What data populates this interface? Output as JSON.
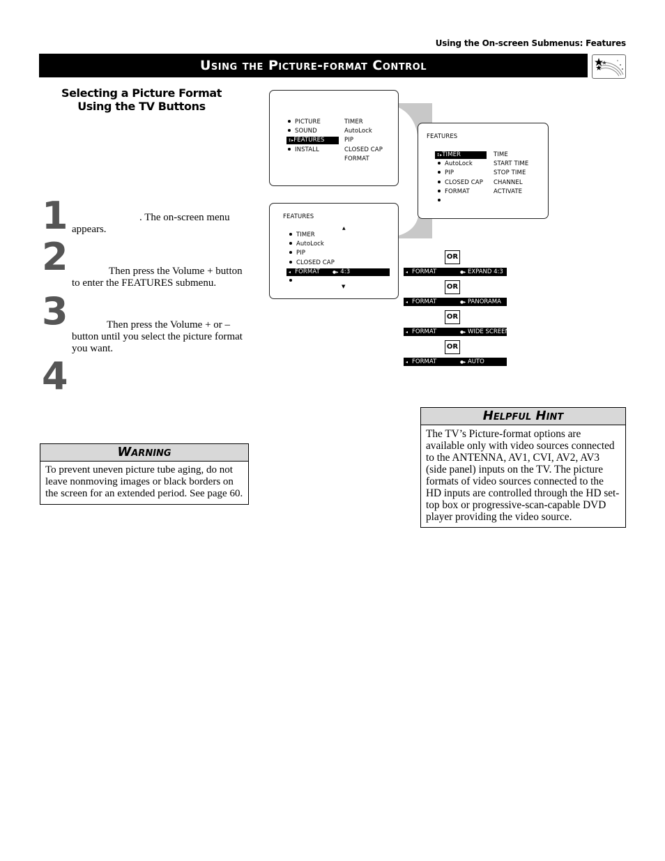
{
  "running_head": "Using the On-screen Submenus: Features",
  "title": "Using the Picture-format Control",
  "title_icon": "shooting-stars-icon",
  "subhead": {
    "line1": "Selecting a Picture Format",
    "line2": "Using the TV Buttons"
  },
  "steps": [
    {
      "number": "1",
      "text": ". The on-screen menu appears."
    },
    {
      "number": "2",
      "text": "Then press the Volume + button to enter the FEATURES submenu."
    },
    {
      "number": "3",
      "text": "Then press the Volume + or – button until you select the picture format you want."
    },
    {
      "number": "4",
      "text": ""
    }
  ],
  "warning": {
    "title": "Warning",
    "text": "To prevent uneven picture tube aging, do not leave nonmoving images or black borders on the screen for an extended period. See page 60."
  },
  "hint": {
    "title": "Helpful Hint",
    "text": "The TV’s Picture-format options are available only with video sources connected to the ANTENNA, AV1, CVI, AV2, AV3 (side panel) inputs on the TV. The picture formats of video sources connected to the HD inputs are controlled through the HD set-top box or progressive-scan-capable DVD player providing the video source."
  },
  "screen_main": {
    "left": [
      "PICTURE",
      "SOUND",
      "FEATURES",
      "INSTALL"
    ],
    "selected": "FEATURES",
    "right": [
      "TIMER",
      "AutoLock",
      "PIP",
      "CLOSED CAP",
      "FORMAT"
    ]
  },
  "screen_features": {
    "title": "FEATURES",
    "left": [
      "TIMER",
      "AutoLock",
      "PIP",
      "CLOSED CAP",
      "FORMAT",
      ""
    ],
    "selected": "TIMER",
    "right": [
      "TIME",
      "START TIME",
      "STOP TIME",
      "CHANNEL",
      "ACTIVATE"
    ]
  },
  "screen_format": {
    "title": "FEATURES",
    "items": [
      "TIMER",
      "AutoLock",
      "PIP",
      "CLOSED CAP"
    ],
    "selected_label": "FORMAT",
    "selected_value": "4:3"
  },
  "format_options": [
    {
      "or": "OR",
      "label": "FORMAT",
      "value": "EXPAND 4:3"
    },
    {
      "or": "OR",
      "label": "FORMAT",
      "value": "PANORAMA"
    },
    {
      "or": "OR",
      "label": "FORMAT",
      "value": "WIDE SCREEN"
    },
    {
      "or": "OR",
      "label": "FORMAT",
      "value": "AUTO"
    }
  ],
  "colors": {
    "title_bar": "#000000",
    "box_header": "#d8d8d8",
    "step_number": "#555555",
    "callout": "#c8c8c8"
  }
}
